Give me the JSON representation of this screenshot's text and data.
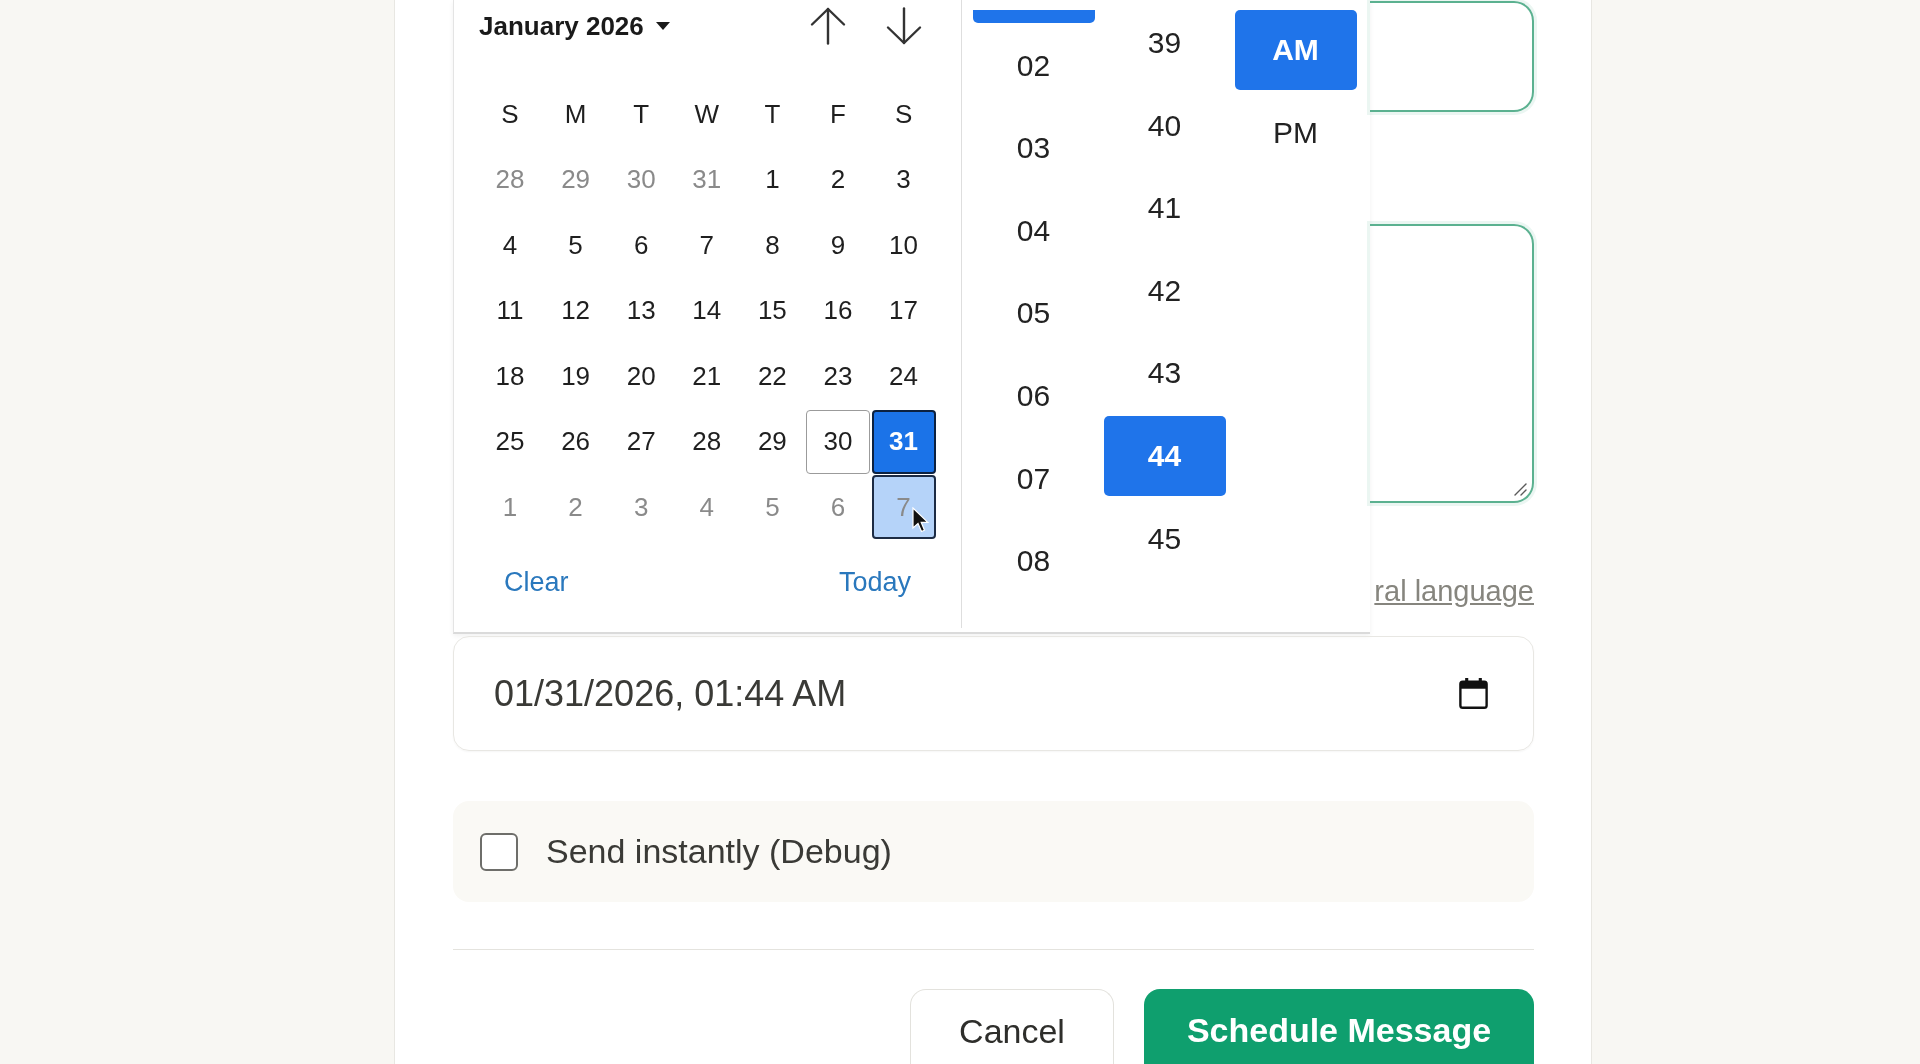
{
  "calendar": {
    "month_label": "January 2026",
    "weekdays": [
      "S",
      "M",
      "T",
      "W",
      "T",
      "F",
      "S"
    ],
    "weeks": [
      [
        {
          "label": "28",
          "outside_month": true,
          "today": false,
          "selected": false,
          "hovered": false
        },
        {
          "label": "29",
          "outside_month": true,
          "today": false,
          "selected": false,
          "hovered": false
        },
        {
          "label": "30",
          "outside_month": true,
          "today": false,
          "selected": false,
          "hovered": false
        },
        {
          "label": "31",
          "outside_month": true,
          "today": false,
          "selected": false,
          "hovered": false
        },
        {
          "label": "1",
          "outside_month": false,
          "today": false,
          "selected": false,
          "hovered": false
        },
        {
          "label": "2",
          "outside_month": false,
          "today": false,
          "selected": false,
          "hovered": false
        },
        {
          "label": "3",
          "outside_month": false,
          "today": false,
          "selected": false,
          "hovered": false
        }
      ],
      [
        {
          "label": "4",
          "outside_month": false,
          "today": false,
          "selected": false,
          "hovered": false
        },
        {
          "label": "5",
          "outside_month": false,
          "today": false,
          "selected": false,
          "hovered": false
        },
        {
          "label": "6",
          "outside_month": false,
          "today": false,
          "selected": false,
          "hovered": false
        },
        {
          "label": "7",
          "outside_month": false,
          "today": false,
          "selected": false,
          "hovered": false
        },
        {
          "label": "8",
          "outside_month": false,
          "today": false,
          "selected": false,
          "hovered": false
        },
        {
          "label": "9",
          "outside_month": false,
          "today": false,
          "selected": false,
          "hovered": false
        },
        {
          "label": "10",
          "outside_month": false,
          "today": false,
          "selected": false,
          "hovered": false
        }
      ],
      [
        {
          "label": "11",
          "outside_month": false,
          "today": false,
          "selected": false,
          "hovered": false
        },
        {
          "label": "12",
          "outside_month": false,
          "today": false,
          "selected": false,
          "hovered": false
        },
        {
          "label": "13",
          "outside_month": false,
          "today": false,
          "selected": false,
          "hovered": false
        },
        {
          "label": "14",
          "outside_month": false,
          "today": false,
          "selected": false,
          "hovered": false
        },
        {
          "label": "15",
          "outside_month": false,
          "today": false,
          "selected": false,
          "hovered": false
        },
        {
          "label": "16",
          "outside_month": false,
          "today": false,
          "selected": false,
          "hovered": false
        },
        {
          "label": "17",
          "outside_month": false,
          "today": false,
          "selected": false,
          "hovered": false
        }
      ],
      [
        {
          "label": "18",
          "outside_month": false,
          "today": false,
          "selected": false,
          "hovered": false
        },
        {
          "label": "19",
          "outside_month": false,
          "today": false,
          "selected": false,
          "hovered": false
        },
        {
          "label": "20",
          "outside_month": false,
          "today": false,
          "selected": false,
          "hovered": false
        },
        {
          "label": "21",
          "outside_month": false,
          "today": false,
          "selected": false,
          "hovered": false
        },
        {
          "label": "22",
          "outside_month": false,
          "today": false,
          "selected": false,
          "hovered": false
        },
        {
          "label": "23",
          "outside_month": false,
          "today": false,
          "selected": false,
          "hovered": false
        },
        {
          "label": "24",
          "outside_month": false,
          "today": false,
          "selected": false,
          "hovered": false
        }
      ],
      [
        {
          "label": "25",
          "outside_month": false,
          "today": false,
          "selected": false,
          "hovered": false
        },
        {
          "label": "26",
          "outside_month": false,
          "today": false,
          "selected": false,
          "hovered": false
        },
        {
          "label": "27",
          "outside_month": false,
          "today": false,
          "selected": false,
          "hovered": false
        },
        {
          "label": "28",
          "outside_month": false,
          "today": false,
          "selected": false,
          "hovered": false
        },
        {
          "label": "29",
          "outside_month": false,
          "today": false,
          "selected": false,
          "hovered": false
        },
        {
          "label": "30",
          "outside_month": false,
          "today": true,
          "selected": false,
          "hovered": false
        },
        {
          "label": "31",
          "outside_month": false,
          "today": false,
          "selected": true,
          "hovered": false
        }
      ],
      [
        {
          "label": "1",
          "outside_month": true,
          "today": false,
          "selected": false,
          "hovered": false
        },
        {
          "label": "2",
          "outside_month": true,
          "today": false,
          "selected": false,
          "hovered": false
        },
        {
          "label": "3",
          "outside_month": true,
          "today": false,
          "selected": false,
          "hovered": false
        },
        {
          "label": "4",
          "outside_month": true,
          "today": false,
          "selected": false,
          "hovered": false
        },
        {
          "label": "5",
          "outside_month": true,
          "today": false,
          "selected": false,
          "hovered": false
        },
        {
          "label": "6",
          "outside_month": true,
          "today": false,
          "selected": false,
          "hovered": false
        },
        {
          "label": "7",
          "outside_month": true,
          "today": false,
          "selected": false,
          "hovered": true
        }
      ]
    ],
    "clear_label": "Clear",
    "today_label": "Today"
  },
  "time": {
    "hours": {
      "selection_scrolled_above": true,
      "options": [
        {
          "label": "02",
          "selected": false
        },
        {
          "label": "03",
          "selected": false
        },
        {
          "label": "04",
          "selected": false
        },
        {
          "label": "05",
          "selected": false
        },
        {
          "label": "06",
          "selected": false
        },
        {
          "label": "07",
          "selected": false
        },
        {
          "label": "08",
          "selected": false
        }
      ]
    },
    "minutes": {
      "options": [
        {
          "label": "39",
          "selected": false
        },
        {
          "label": "40",
          "selected": false
        },
        {
          "label": "41",
          "selected": false
        },
        {
          "label": "42",
          "selected": false
        },
        {
          "label": "43",
          "selected": false
        },
        {
          "label": "44",
          "selected": true
        },
        {
          "label": "45",
          "selected": false
        }
      ]
    },
    "periods": {
      "options": [
        {
          "label": "AM",
          "selected": true
        },
        {
          "label": "PM",
          "selected": false
        }
      ]
    }
  },
  "fields_behind_popup": [
    {
      "kind": "input"
    },
    {
      "kind": "textarea"
    }
  ],
  "language_link": "ral language",
  "datetime_field": {
    "value": "01/31/2026, 01:44 AM"
  },
  "debug_option": {
    "label": "Send instantly (Debug)",
    "checked": false
  },
  "buttons": [
    {
      "label": "Cancel",
      "kind": "secondary"
    },
    {
      "label": "Schedule Message",
      "kind": "primary"
    }
  ]
}
